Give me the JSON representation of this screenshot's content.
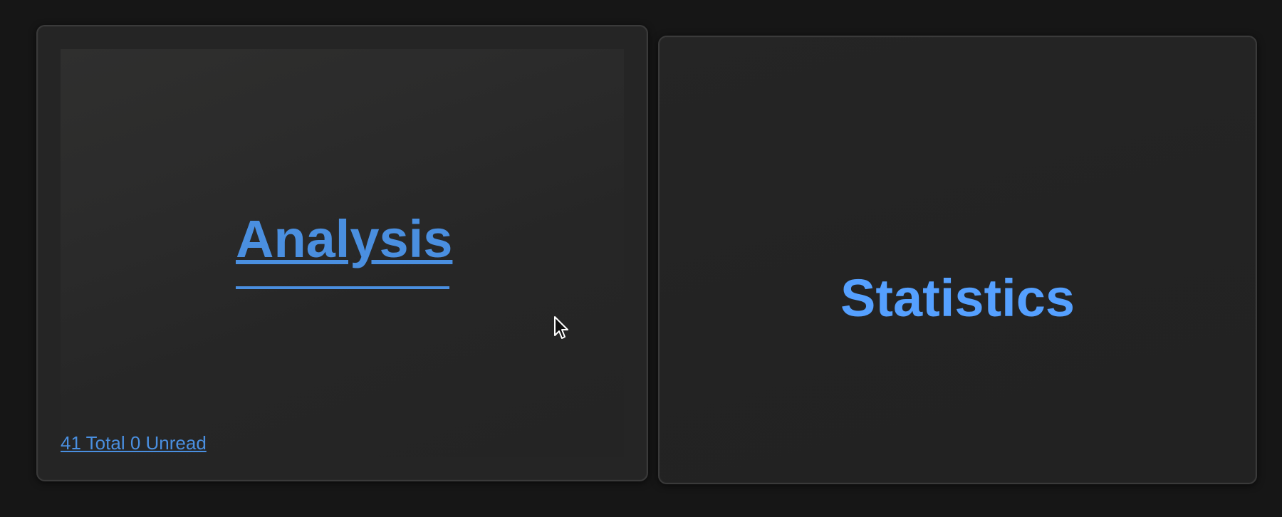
{
  "cards": [
    {
      "title": "Analysis",
      "counts_label": "41 Total 0 Unread"
    },
    {
      "title": "Statistics"
    }
  ],
  "colors": {
    "link": "#4a8fe0",
    "link_bright": "#55a0ff",
    "background": "#161616",
    "card": "#252525"
  },
  "icons": {
    "cursor": "mouse-pointer-icon"
  }
}
